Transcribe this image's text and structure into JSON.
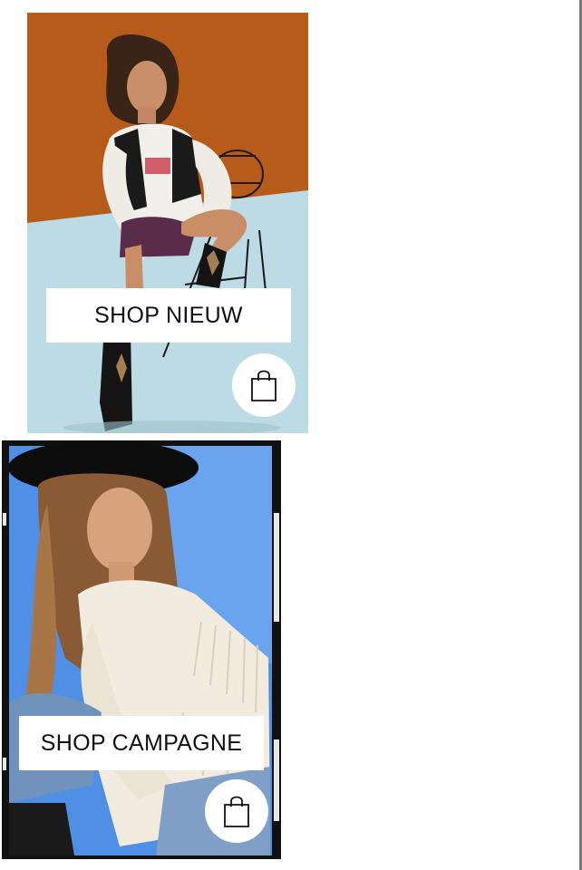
{
  "cards": [
    {
      "cta_label": "SHOP NIEUW",
      "icon": "shopping-bag-icon",
      "colors": {
        "backdrop": "#b85d1a",
        "floor": "#bcdbe4"
      }
    },
    {
      "cta_label": "SHOP CAMPAGNE",
      "icon": "shopping-bag-icon",
      "colors": {
        "backdrop": "#4f8fe6",
        "frame": "#111111"
      }
    }
  ]
}
